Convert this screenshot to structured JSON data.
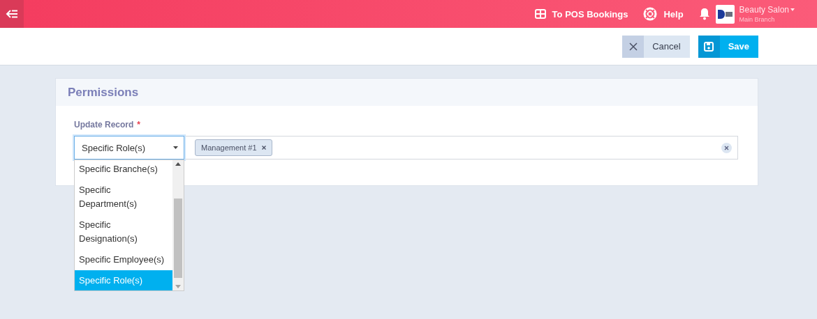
{
  "topbar": {
    "links": [
      {
        "kind": "pos",
        "label": "To POS Bookings"
      },
      {
        "kind": "help",
        "label": "Help"
      }
    ],
    "account": {
      "name": "Beauty Salon",
      "branch": "Main Branch"
    }
  },
  "actions": [
    {
      "kind": "cancel",
      "label": "Cancel"
    },
    {
      "kind": "save",
      "label": "Save"
    }
  ],
  "section": {
    "title": "Permissions",
    "field": {
      "label": "Update Record",
      "required_mark": "*",
      "select_value": "Specific Role(s)",
      "tags": [
        {
          "label": "Management #1"
        }
      ],
      "options": [
        {
          "label": "Specific Branche(s)",
          "selected": false
        },
        {
          "label": "Specific Department(s)",
          "selected": false
        },
        {
          "label": "Specific Designation(s)",
          "selected": false
        },
        {
          "label": "Specific Employee(s)",
          "selected": false
        },
        {
          "label": "Specific Role(s)",
          "selected": true
        }
      ]
    }
  }
}
